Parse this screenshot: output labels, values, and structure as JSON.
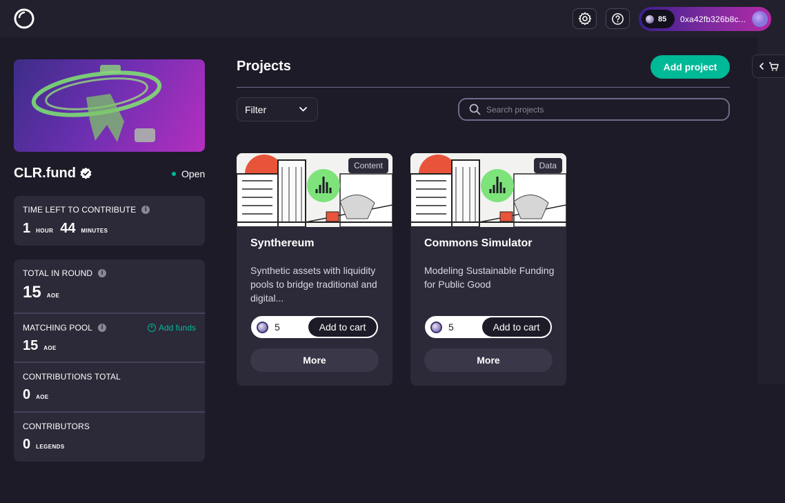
{
  "wallet": {
    "balance": "85",
    "address": "0xa42fb326b8c..."
  },
  "round": {
    "name": "CLR.fund",
    "status": "Open",
    "time_left_label": "TIME LEFT TO CONTRIBUTE",
    "hours": "1",
    "hours_unit": "hour",
    "minutes": "44",
    "minutes_unit": "minutes",
    "total_label": "TOTAL IN ROUND",
    "total_value": "15",
    "total_unit": "AOE",
    "matching_label": "MATCHING POOL",
    "add_funds": "Add funds",
    "matching_value": "15",
    "matching_unit": "AOE",
    "contributions_label": "CONTRIBUTIONS TOTAL",
    "contributions_value": "0",
    "contributions_unit": "AOE",
    "contributors_label": "CONTRIBUTORS",
    "contributors_value": "0",
    "contributors_unit": "legends"
  },
  "main": {
    "title": "Projects",
    "add_project": "Add project",
    "filter": "Filter",
    "search_placeholder": "Search projects"
  },
  "projects": [
    {
      "tag": "Content",
      "title": "Synthereum",
      "description": "Synthetic assets with liquidity pools to bridge traditional and digital...",
      "quantity": "5",
      "add_to_cart": "Add to cart",
      "more": "More"
    },
    {
      "tag": "Data",
      "title": "Commons Simulator",
      "description": "Modeling Sustainable Funding for Public Good",
      "quantity": "5",
      "add_to_cart": "Add to cart",
      "more": "More"
    }
  ],
  "colors": {
    "background": "#1d1b27",
    "card": "#2c2a38",
    "accent": "#00b996",
    "wallet_gradient_start": "#3b1f8c",
    "wallet_gradient_end": "#b32aa8"
  },
  "icons": [
    "logo-icon",
    "gear-icon",
    "help-icon",
    "verified-icon",
    "info-icon",
    "add-circle-icon",
    "chevron-down-icon",
    "search-icon",
    "chevron-left-icon",
    "cart-icon"
  ]
}
